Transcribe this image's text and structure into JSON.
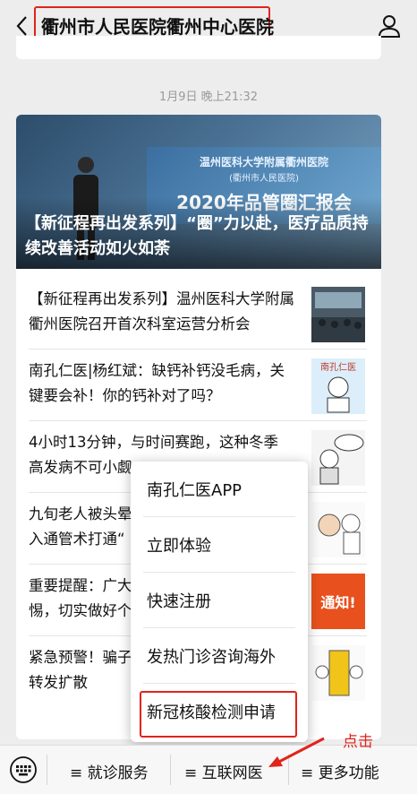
{
  "header": {
    "title": "衢州市人民医院衢州中心医院",
    "back_icon": "chevron-left-icon",
    "profile_icon": "user-icon"
  },
  "timestamp": "1月9日 晚上21:32",
  "hero": {
    "title": "【新征程再出发系列】“圈”力以赴，医疗品质持续改善活动如火如荼",
    "screen_line1": "温州医科大学附属衢州医院",
    "screen_line2": "(衢州市人民医院)",
    "screen_line3": "2020年品管圈汇报会"
  },
  "articles": [
    {
      "line1": "【新征程再出发系列】温州医科大学附属",
      "line2": "衢州医院召开首次科室运营分析会"
    },
    {
      "line1": "南孔仁医|杨红斌：缺钙补钙没毛病，关",
      "line2": "键要会补！你的钙补对了吗？",
      "thumb_text": "南孔仁医"
    },
    {
      "line1": "4小时13分钟，与时间赛跑，这种冬季",
      "line2": "高发病不可小觑"
    },
    {
      "line1": "九旬老人被头晕",
      "line2": "入通管术打通“"
    },
    {
      "line1": "重要提醒：广大",
      "line2": "惕，切实做好个",
      "thumb_text": "通知!"
    },
    {
      "line1": "紧急预警！骗子",
      "line2": "转发扩散"
    }
  ],
  "popup_menu": [
    "南孔仁医APP",
    "立即体验",
    "快速注册",
    "发热门诊咨询海外",
    "新冠核酸检测申请"
  ],
  "annotation": {
    "click_label": "点击",
    "accent": "#e0241b"
  },
  "tabbar": {
    "keyboard_icon": "keyboard-icon",
    "tabs": [
      "≡ 就诊服务",
      "≡ 互联网医",
      "≡ 更多功能"
    ]
  }
}
